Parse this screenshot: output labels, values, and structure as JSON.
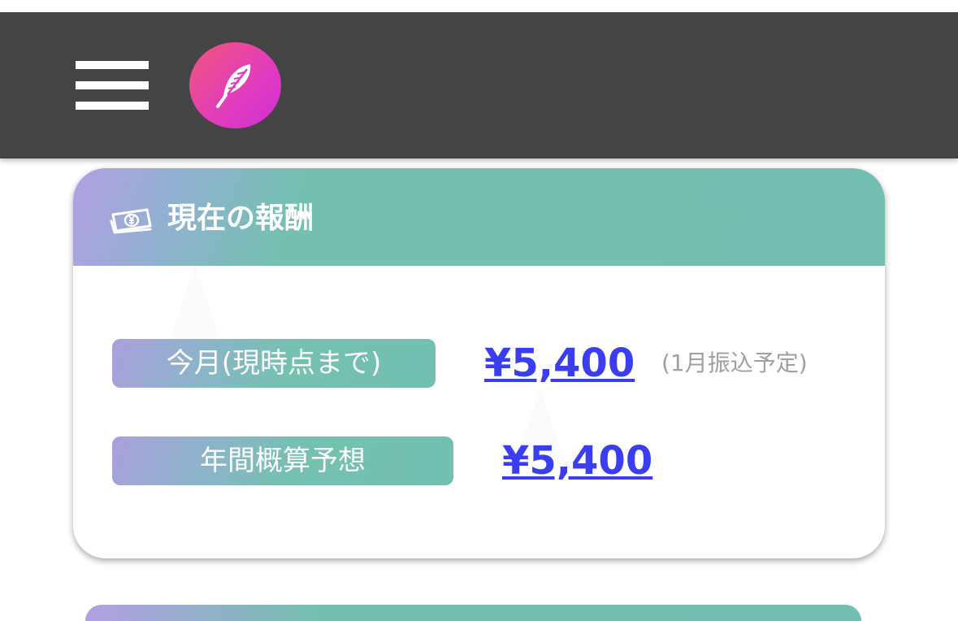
{
  "header": {
    "menu_icon": "hamburger-menu-icon",
    "logo_icon": "feather-icon",
    "logo_colors": [
      "#f2557b",
      "#cf2fd8"
    ],
    "background": "#444444"
  },
  "card": {
    "icon": "money-bill-yen-icon",
    "title": "現在の報酬",
    "accent_colors": [
      "#b29fe3",
      "#72bfb1"
    ],
    "rows": [
      {
        "label": "今月(現時点まで)",
        "amount": "¥5,400",
        "note": "(1月振込予定)"
      },
      {
        "label": "年間概算予想",
        "amount": "¥5,400"
      }
    ],
    "amount_color": "#3a3df0"
  }
}
